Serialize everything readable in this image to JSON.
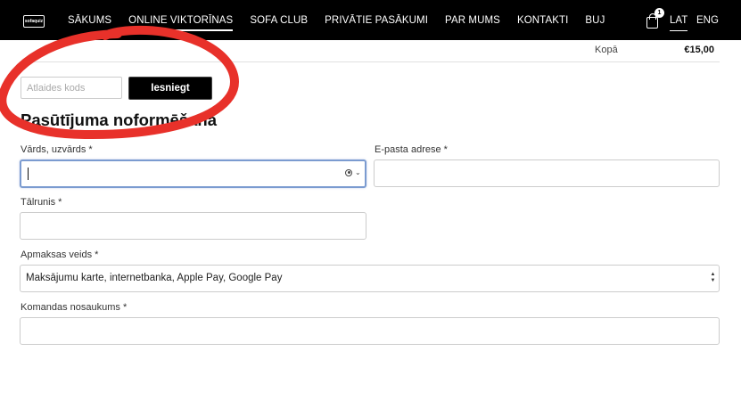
{
  "nav": {
    "logo_text": "sofaquiz",
    "items": [
      {
        "label": "SĀKUMS",
        "active": false
      },
      {
        "label": "ONLINE VIKTORĪNAS",
        "active": true
      },
      {
        "label": "SOFA CLUB",
        "active": false
      },
      {
        "label": "PRIVĀTIE PASĀKUMI",
        "active": false
      },
      {
        "label": "PAR MUMS",
        "active": false
      },
      {
        "label": "KONTAKTI",
        "active": false
      },
      {
        "label": "BUJ",
        "active": false
      }
    ],
    "cart_count": "1",
    "languages": {
      "current": "LAT",
      "other": "ENG"
    }
  },
  "order_summary": {
    "total_label": "Kopā",
    "total_value": "€15,00"
  },
  "coupon": {
    "placeholder": "Atlaides kods",
    "submit_label": "Iesniegt"
  },
  "checkout": {
    "title": "Pasūtījuma noformēšana",
    "fields": {
      "name": {
        "label": "Vārds, uzvārds *",
        "value": ""
      },
      "email": {
        "label": "E-pasta adrese *",
        "value": ""
      },
      "phone": {
        "label": "Tālrunis *",
        "value": ""
      },
      "payment": {
        "label": "Apmaksas veids *",
        "selected": "Maksājumu karte, internetbanka, Apple Pay, Google Pay"
      },
      "team": {
        "label": "Komandas nosaukums *",
        "value": ""
      }
    }
  },
  "annotation": {
    "shape": "ellipse",
    "color": "#e8312a"
  },
  "colors": {
    "nav_bg": "#000000",
    "focus_border": "#7b9bd0",
    "annotation": "#e8312a"
  }
}
